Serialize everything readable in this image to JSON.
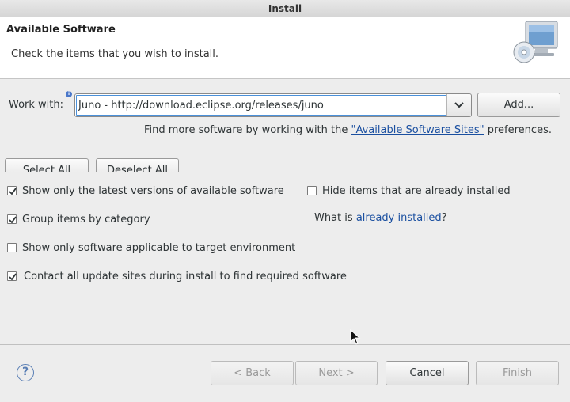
{
  "window": {
    "title": "Install"
  },
  "header": {
    "title": "Available Software",
    "description": "Check the items that you wish to install."
  },
  "work_with": {
    "label": "Work with:",
    "value": "Juno - http://download.eclipse.org/releases/juno",
    "add_button": "Add..."
  },
  "sites_hint": {
    "prefix": "Find more software by working with the ",
    "link": "\"Available Software Sites\"",
    "suffix": " preferences."
  },
  "selection_buttons": {
    "select_all": "Select All",
    "deselect_all": "Deselect All"
  },
  "options": {
    "latest_versions": {
      "label": "Show only the latest versions of available software",
      "checked": true
    },
    "hide_installed": {
      "label": "Hide items that are already installed",
      "checked": false
    },
    "group_by_category": {
      "label": "Group items by category",
      "checked": true
    },
    "target_env": {
      "label": "Show only software applicable to target environment",
      "checked": false
    },
    "contact_sites": {
      "label": "Contact all update sites during install to find required software",
      "checked": true
    }
  },
  "already_installed": {
    "prefix": "What is ",
    "link": "already installed",
    "suffix": "?"
  },
  "footer": {
    "back": "< Back",
    "next": "Next >",
    "cancel": "Cancel",
    "finish": "Finish"
  }
}
